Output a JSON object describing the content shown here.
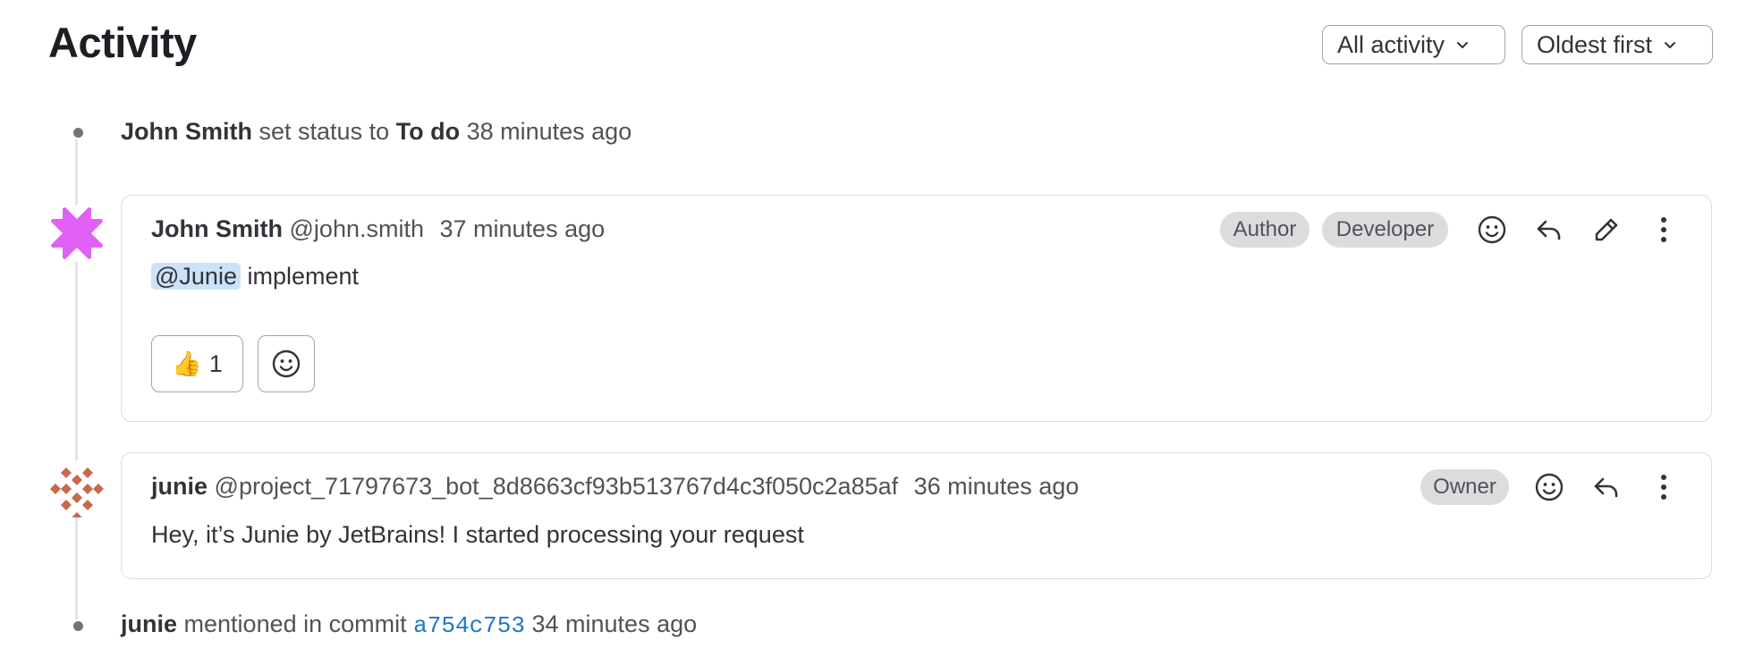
{
  "header": {
    "title": "Activity",
    "filter_label": "All activity",
    "sort_label": "Oldest first"
  },
  "events": [
    {
      "actor": "John Smith",
      "text": "set status to",
      "status": "To do",
      "time": "38 minutes ago"
    },
    {
      "actor": "junie",
      "text": "mentioned in commit",
      "commit": "a754c753",
      "time": "34 minutes ago"
    }
  ],
  "notes": [
    {
      "author": "John Smith",
      "username": "@john.smith",
      "time": "37 minutes ago",
      "badges": [
        "Author",
        "Developer"
      ],
      "mention": "@Junie",
      "text": "implement",
      "reactions": [
        {
          "emoji": "👍",
          "count": "1"
        }
      ]
    },
    {
      "author": "junie",
      "username": "@project_71797673_bot_8d8663cf93b513767d4c3f050c2a85af",
      "time": "36 minutes ago",
      "badges": [
        "Owner"
      ],
      "text": "Hey, it’s Junie by JetBrains! I started processing your request"
    }
  ],
  "colors": {
    "mention_bg": "#cbe2f9",
    "commit_link": "#1f75cb",
    "avatar1": "#e160f5",
    "avatar2": "#c8694c"
  },
  "icons": [
    "chevron-down-icon",
    "smiley-icon",
    "reply-icon",
    "pencil-icon",
    "kebab-icon"
  ]
}
